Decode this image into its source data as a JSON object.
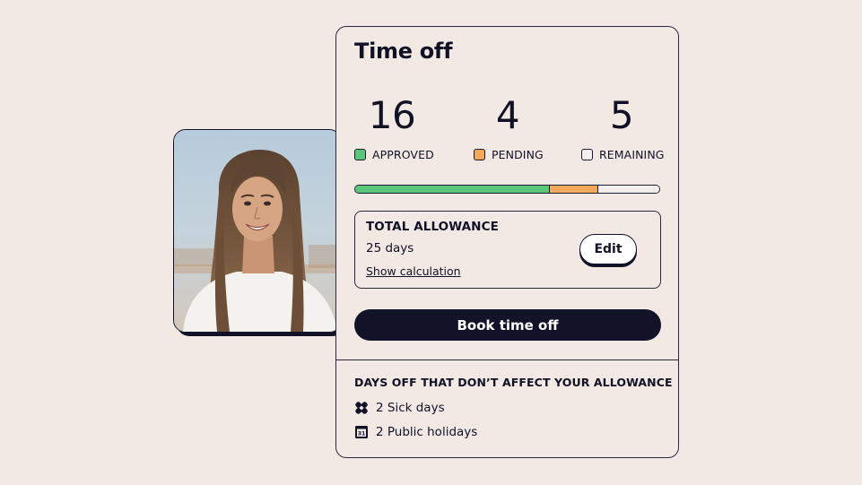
{
  "time_off": {
    "title": "Time off",
    "stats": {
      "approved": {
        "value": "16",
        "label": "APPROVED",
        "color": "#5bc77a"
      },
      "pending": {
        "value": "4",
        "label": "PENDING",
        "color": "#f2a95a"
      },
      "remaining": {
        "value": "5",
        "label": "REMAINING",
        "color": "#f4eeee"
      }
    },
    "progress": {
      "approved_days": 16,
      "pending_days": 4,
      "remaining_days": 5,
      "total_days": 25
    },
    "allowance": {
      "title": "TOTAL ALLOWANCE",
      "value": "25 days",
      "link_label": "Show calculation",
      "edit_label": "Edit"
    },
    "book_button_label": "Book time off",
    "other_days": {
      "heading": "DAYS OFF THAT DON’T AFFECT YOUR ALLOWANCE",
      "items": [
        {
          "icon": "bandage-icon",
          "label": "2 Sick days"
        },
        {
          "icon": "calendar-icon",
          "label": "2 Public holidays",
          "icon_text": "31"
        }
      ]
    }
  },
  "colors": {
    "background": "#f2e9e4",
    "ink": "#121229",
    "approved": "#5bc77a",
    "pending": "#f2a95a",
    "remaining": "#f4eeee"
  }
}
